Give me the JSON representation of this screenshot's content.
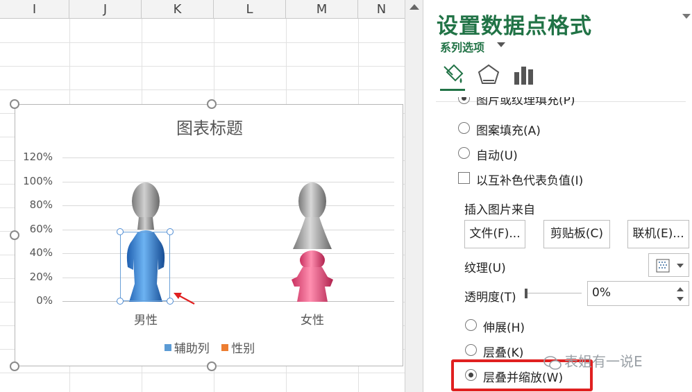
{
  "sheet": {
    "columns": [
      "I",
      "J",
      "K",
      "L",
      "M",
      "N"
    ]
  },
  "chart": {
    "legend": [
      {
        "label": "辅助列",
        "color": "#5b9bd5"
      },
      {
        "label": "性别",
        "color": "#ed7d31"
      }
    ]
  },
  "chart_data": {
    "type": "bar",
    "title": "图表标题",
    "categories": [
      "男性",
      "女性"
    ],
    "y_ticks": [
      "0%",
      "20%",
      "40%",
      "60%",
      "80%",
      "100%",
      "120%"
    ],
    "ylim": [
      0,
      1.2
    ],
    "series": [
      {
        "name": "辅助列",
        "values": [
          1.0,
          1.0
        ],
        "color": "#5b9bd5"
      },
      {
        "name": "性别",
        "values": [
          0.6,
          0.4
        ],
        "color": "#ed7d31"
      }
    ],
    "legend_position": "bottom",
    "grid": true
  },
  "pane": {
    "title": "设置数据点格式",
    "series_options": "系列选项",
    "tabs": [
      "fill-line-icon",
      "effects-pentagon-icon",
      "series-options-bar-icon"
    ],
    "partial_option": "图片或纹理填充(P)",
    "pattern_fill": "图案填充(A)",
    "auto": "自动(U)",
    "invert_if_negative": "以互补色代表负值(I)",
    "insert_picture_from": "插入图片来自",
    "btn_file": "文件(F)...",
    "btn_clipboard": "剪贴板(C)",
    "btn_online": "联机(E)...",
    "texture_label": "纹理(U)",
    "transparency_label": "透明度(T)",
    "transparency_value": "0%",
    "stretch": "伸展(H)",
    "stack": "层叠(K)",
    "stack_and_scale": "层叠并缩放(W)",
    "selected_option": "stack_and_scale"
  },
  "watermark": "表姐有一说E"
}
